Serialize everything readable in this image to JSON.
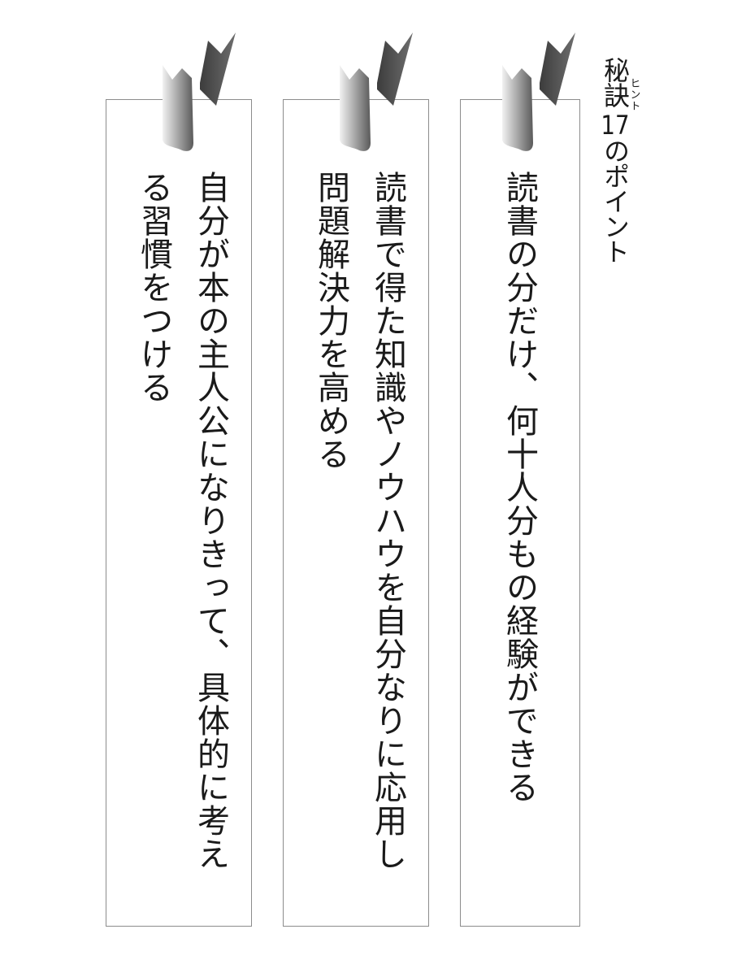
{
  "heading": {
    "prefix": "秘",
    "ruby_base": "訣",
    "ruby_text": "ヒント",
    "number": "17",
    "suffix": "のポイント"
  },
  "cards": [
    {
      "text": "読書の分だけ、何十人分もの経験ができる"
    },
    {
      "text": "読書で得た知識やノウハウを自分なりに応用し問題解決力を高める"
    },
    {
      "text": "自分が本の主人公になりきって、具体的に考える習慣をつける"
    }
  ],
  "colors": {
    "border": "#8c8c8c",
    "ribbon_dark": "#4a4a4a",
    "ribbon_light": "#d9d9d9",
    "text": "#1a1a1a"
  },
  "icons": {
    "ribbon": "bookmark-ribbon-icon"
  }
}
